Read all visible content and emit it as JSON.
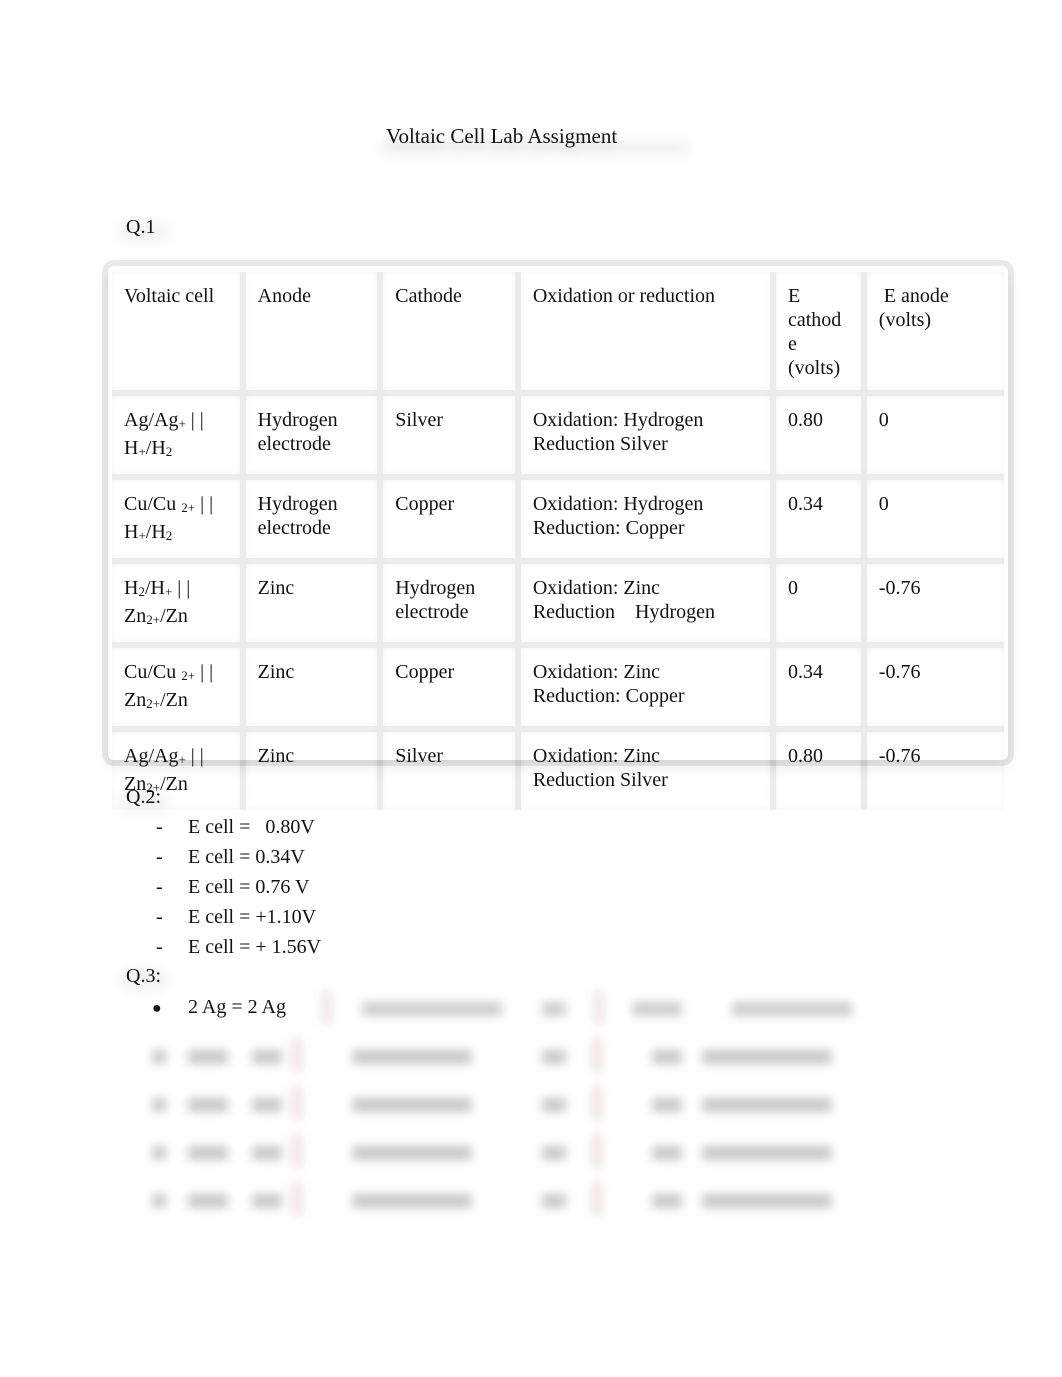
{
  "document": {
    "title": "Voltaic Cell Lab Assigment"
  },
  "q1": {
    "label": "Q.1",
    "table": {
      "headers": [
        "Voltaic cell",
        "Anode",
        "Cathode",
        "Oxidation or reduction",
        "E cathode (volts)",
        " E anode (volts)"
      ],
      "header_lines": {
        "e_cathode": [
          "E",
          "cathod",
          "e",
          "(volts)"
        ],
        "e_anode": [
          " E anode",
          "(volts)"
        ]
      },
      "rows": [
        {
          "cell_line1": "Ag/Ag",
          "cell_line1_sup": "+",
          "cell_line1_end": " | |",
          "cell_line2": "H",
          "cell_line2_sup": "+",
          "cell_line2_mid": "/H",
          "cell_line2_sub": "2",
          "cell_line2_end": "",
          "anode": [
            "Hydrogen",
            "electrode"
          ],
          "cathode": [
            "Silver"
          ],
          "oxred": [
            "Oxidation: Hydrogen",
            "Reduction Silver"
          ],
          "e_cathode": "0.80",
          "e_anode": "0"
        },
        {
          "cell_line1": "Cu/Cu ",
          "cell_line1_sup": "2+",
          "cell_line1_end": " | |",
          "cell_line2": "H",
          "cell_line2_sup": "+",
          "cell_line2_mid": "/H",
          "cell_line2_sub": "2",
          "cell_line2_end": "",
          "anode": [
            "Hydrogen",
            "electrode"
          ],
          "cathode": [
            "Copper"
          ],
          "oxred": [
            "Oxidation: Hydrogen",
            "Reduction: Copper"
          ],
          "e_cathode": "0.34",
          "e_anode": "0"
        },
        {
          "cell_line1": "H",
          "cell_line1_sub": "2",
          "cell_line1_mid": "/H",
          "cell_line1_sup": "+",
          "cell_line1_end": " | |",
          "cell_line2": "Zn",
          "cell_line2_sup": "2+",
          "cell_line2_mid": "/Zn",
          "cell_line2_end": "",
          "anode": [
            "Zinc"
          ],
          "cathode": [
            "Hydrogen",
            "electrode"
          ],
          "oxred": [
            "Oxidation: Zinc",
            "Reduction    Hydrogen"
          ],
          "e_cathode": "0",
          "e_anode": "-0.76"
        },
        {
          "cell_line1": "Cu/Cu ",
          "cell_line1_sup": "2+",
          "cell_line1_end": " | |",
          "cell_line2": "Zn",
          "cell_line2_sup": "2+",
          "cell_line2_mid": "/Zn",
          "cell_line2_end": "",
          "anode": [
            "Zinc"
          ],
          "cathode": [
            "Copper"
          ],
          "oxred": [
            "Oxidation: Zinc",
            "Reduction: Copper"
          ],
          "e_cathode": "0.34",
          "e_anode": "-0.76"
        },
        {
          "cell_line1": "Ag/Ag",
          "cell_line1_sup": "+",
          "cell_line1_end": " | |",
          "cell_line2": "Zn",
          "cell_line2_sup": "2+",
          "cell_line2_mid": "/Zn",
          "cell_line2_end": "",
          "anode": [
            "Zinc"
          ],
          "cathode": [
            "Silver"
          ],
          "oxred": [
            "Oxidation: Zinc",
            "Reduction Silver"
          ],
          "e_cathode": "0.80",
          "e_anode": "-0.76"
        }
      ]
    }
  },
  "q2": {
    "label": "Q.2:",
    "bullet_glyph": "-",
    "items": [
      "E cell =   0.80V",
      "E cell = 0.34V",
      "E cell = 0.76 V",
      "E cell = +1.10V",
      "E cell = + 1.56V"
    ]
  },
  "q3": {
    "label": "Q.3:",
    "bullet_glyph": "●",
    "first_item_visible": "2 Ag = 2 Ag",
    "blurred_rows_count": 4
  }
}
